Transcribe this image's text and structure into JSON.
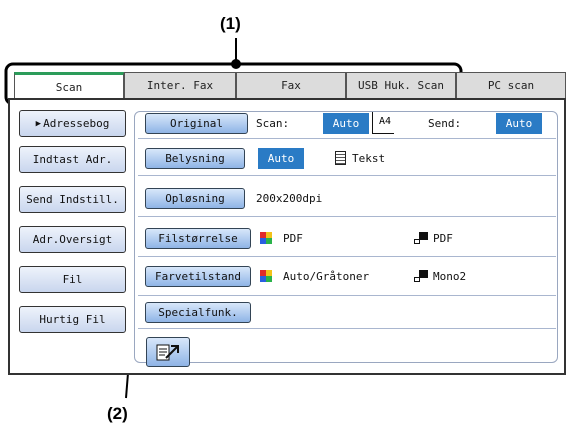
{
  "callouts": {
    "one": "(1)",
    "two": "(2)"
  },
  "tabs": [
    {
      "label": "Scan",
      "active": true
    },
    {
      "label": "Inter. Fax",
      "active": false
    },
    {
      "label": "Fax",
      "active": false
    },
    {
      "label": "USB Huk. Scan",
      "active": false
    },
    {
      "label": "PC scan",
      "active": false
    }
  ],
  "sidebar": [
    {
      "label": "Adressebog",
      "selected": true
    },
    {
      "label": "Indtast Adr."
    },
    {
      "label": "Send Indstill."
    },
    {
      "label": "Adr.Oversigt"
    },
    {
      "label": "Fil"
    },
    {
      "label": "Hurtig Fil"
    }
  ],
  "settings": {
    "original": {
      "button": "Original",
      "scan_label": "Scan:",
      "scan_value": "Auto",
      "paper": "A4",
      "send_label": "Send:",
      "send_value": "Auto"
    },
    "exposure": {
      "button": "Belysning",
      "value": "Auto",
      "mode": "Tekst"
    },
    "resolution": {
      "button": "Opløsning",
      "value": "200x200dpi"
    },
    "file_format": {
      "button": "Filstørrelse",
      "color_value": "PDF",
      "mono_value": "PDF"
    },
    "color_mode": {
      "button": "Farvetilstand",
      "color_value": "Auto/Gråtoner",
      "mono_value": "Mono2"
    },
    "special": {
      "button": "Specialfunk."
    }
  },
  "colors": {
    "tab_active_accent": "#2c9c5a",
    "selected_value": "#2a7bc5",
    "button_blue": "#8fb4e6"
  }
}
